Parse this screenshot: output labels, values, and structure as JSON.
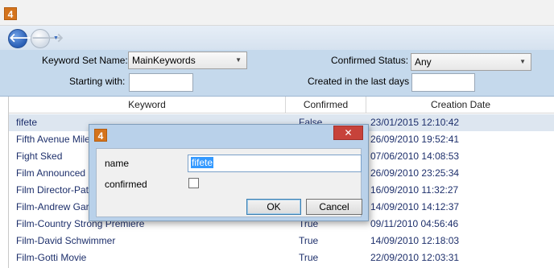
{
  "app": {
    "logo_text": "4"
  },
  "toolbar": {
    "back_glyph": "🡐",
    "forward_glyph": "🡒",
    "dropdown_glyph": "▼"
  },
  "filters": {
    "keyword_set_label": "Keyword Set Name:",
    "keyword_set_value": "MainKeywords",
    "starting_with_label": "Starting with:",
    "starting_with_value": "",
    "confirmed_status_label": "Confirmed Status:",
    "confirmed_status_value": "Any",
    "created_last_days_label": "Created in the last days",
    "created_last_days_value": ""
  },
  "grid": {
    "columns": [
      "Keyword",
      "Confirmed",
      "Creation Date"
    ],
    "rows": [
      {
        "keyword": "fifete",
        "confirmed": "False",
        "date": "23/01/2015 12:10:42"
      },
      {
        "keyword": "Fifth Avenue Mile",
        "confirmed": "",
        "date": "26/09/2010 19:52:41"
      },
      {
        "keyword": "Fight Sked",
        "confirmed": "",
        "date": "07/06/2010 14:08:53"
      },
      {
        "keyword": "Film Announced",
        "confirmed": "",
        "date": "26/09/2010 23:25:34"
      },
      {
        "keyword": "Film Director-Patel",
        "confirmed": "",
        "date": "16/09/2010 11:32:27"
      },
      {
        "keyword": "Film-Andrew Garfield",
        "confirmed": "",
        "date": "14/09/2010 14:12:37"
      },
      {
        "keyword": "Film-Country Strong Premiere",
        "confirmed": "True",
        "date": "09/11/2010 04:56:46"
      },
      {
        "keyword": "Film-David Schwimmer",
        "confirmed": "True",
        "date": "14/09/2010 12:18:03"
      },
      {
        "keyword": "Film-Gotti Movie",
        "confirmed": "True",
        "date": "22/09/2010 12:03:31"
      }
    ]
  },
  "dialog": {
    "logo_text": "4",
    "close_glyph": "✕",
    "name_label": "name",
    "name_value": "fifete",
    "confirmed_label": "confirmed",
    "ok_label": "OK",
    "cancel_label": "Cancel"
  }
}
